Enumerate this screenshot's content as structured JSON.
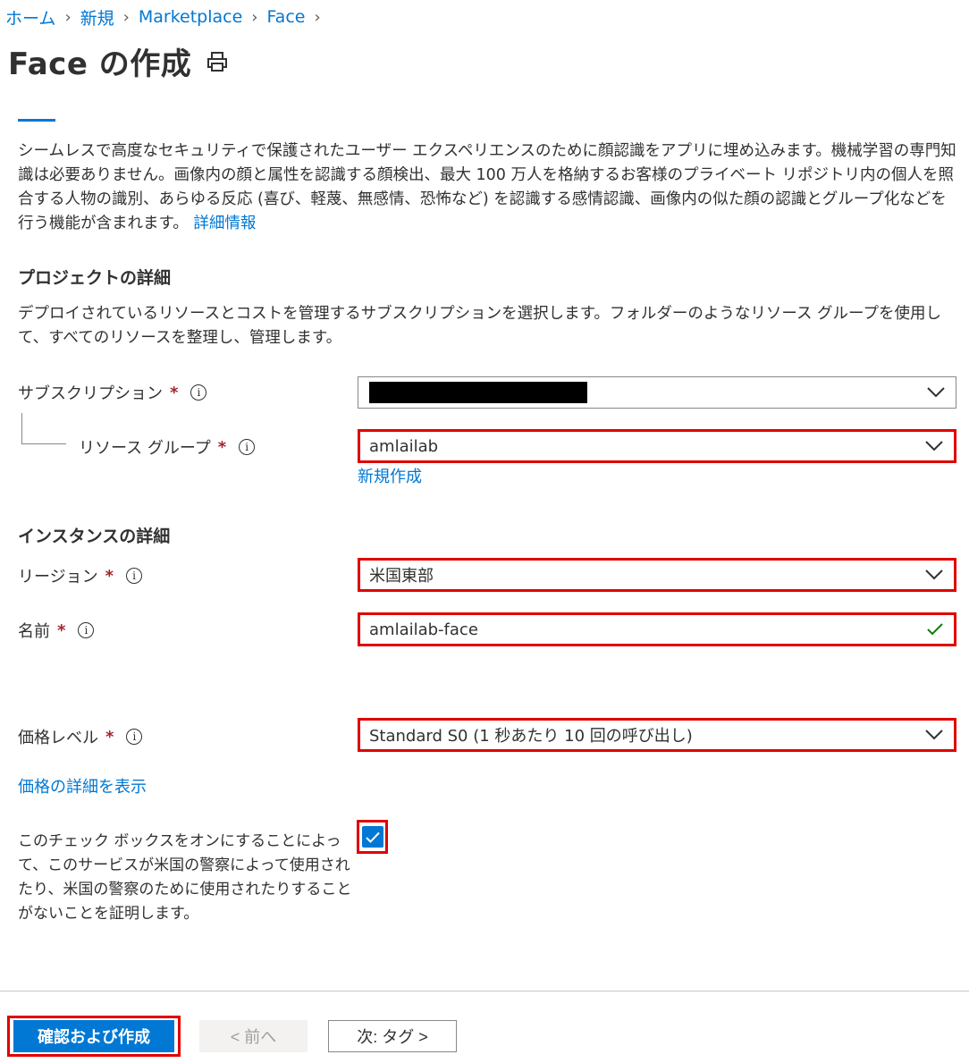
{
  "breadcrumb": [
    "ホーム",
    "新規",
    "Marketplace",
    "Face"
  ],
  "page_title": "Face の作成",
  "description": "シームレスで高度なセキュリティで保護されたユーザー エクスペリエンスのために顔認識をアプリに埋め込みます。機械学習の専門知識は必要ありません。画像内の顔と属性を認識する顔検出、最大 100 万人を格納するお客様のプライベート リポジトリ内の個人を照合する人物の識別、あらゆる反応 (喜び、軽蔑、無感情、恐怖など) を認識する感情認識、画像内の似た顔の認識とグループ化などを行う機能が含まれます。",
  "description_link": "詳細情報",
  "project": {
    "heading": "プロジェクトの詳細",
    "text": "デプロイされているリソースとコストを管理するサブスクリプションを選択します。フォルダーのようなリソース グループを使用して、すべてのリソースを整理し、管理します。",
    "subscription_label": "サブスクリプション",
    "resource_group_label": "リソース グループ",
    "resource_group_value": "amlailab",
    "create_new": "新規作成"
  },
  "instance": {
    "heading": "インスタンスの詳細",
    "region_label": "リージョン",
    "region_value": "米国東部",
    "name_label": "名前",
    "name_value": "amlailab-face"
  },
  "pricing": {
    "label": "価格レベル",
    "value": "Standard S0 (1 秒あたり 10 回の呼び出し)",
    "details_link": "価格の詳細を表示"
  },
  "certification": {
    "text": "このチェック ボックスをオンにすることによって、このサービスが米国の警察によって使用されたり、米国の警察のために使用されたりすることがないことを証明します。",
    "checked": true
  },
  "required_marker": "*",
  "info_glyph": "i",
  "footer": {
    "review_create": "確認および作成",
    "previous": "< 前へ",
    "next": "次: タグ >"
  },
  "colors": {
    "accent": "#0078d4",
    "highlight": "#e00000",
    "required": "#a4262c",
    "valid": "#107c10"
  }
}
